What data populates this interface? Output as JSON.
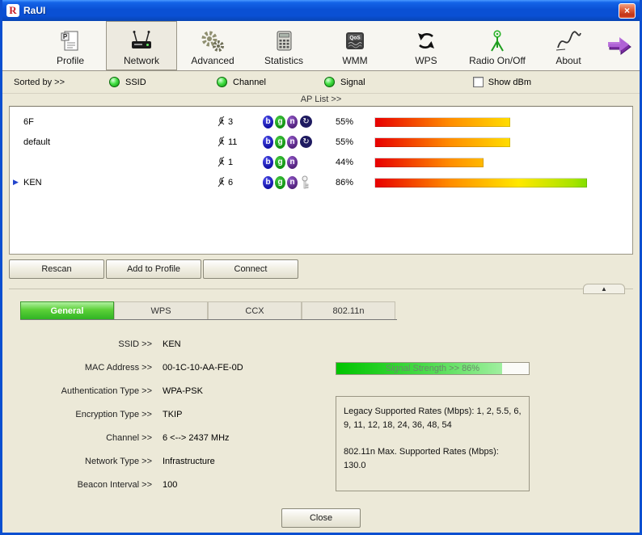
{
  "window": {
    "title": "RaUI",
    "logo": "R"
  },
  "icons": {
    "close": "×",
    "collapse": "▲",
    "connected_arrow": "▶",
    "wps_mini": "↻"
  },
  "toolbar": {
    "items": [
      {
        "label": "Profile"
      },
      {
        "label": "Network",
        "active": true
      },
      {
        "label": "Advanced"
      },
      {
        "label": "Statistics"
      },
      {
        "label": "WMM"
      },
      {
        "label": "WPS"
      },
      {
        "label": "Radio On/Off"
      },
      {
        "label": "About"
      }
    ]
  },
  "sort_bar": {
    "label": "Sorted by >>",
    "options": [
      {
        "label": "SSID"
      },
      {
        "label": "Channel"
      },
      {
        "label": "Signal"
      }
    ],
    "show_dbm": {
      "label": "Show dBm",
      "checked": false
    }
  },
  "ap_list": {
    "header": "AP List >>",
    "rows": [
      {
        "ssid": "6F",
        "channel": "3",
        "modes": [
          "b",
          "g",
          "n"
        ],
        "security": "wps",
        "signal": "55%",
        "connected": false
      },
      {
        "ssid": "default",
        "channel": "11",
        "modes": [
          "b",
          "g",
          "n"
        ],
        "security": "wps",
        "signal": "55%",
        "connected": false
      },
      {
        "ssid": "",
        "channel": "1",
        "modes": [
          "b",
          "g",
          "n"
        ],
        "security": "",
        "signal": "44%",
        "connected": false
      },
      {
        "ssid": "KEN",
        "channel": "6",
        "modes": [
          "b",
          "g",
          "n"
        ],
        "security": "key",
        "signal": "86%",
        "connected": true
      }
    ]
  },
  "actions": {
    "rescan": "Rescan",
    "add_to_profile": "Add to Profile",
    "connect": "Connect"
  },
  "detail": {
    "tabs": [
      {
        "label": "General",
        "active": true
      },
      {
        "label": "WPS"
      },
      {
        "label": "CCX"
      },
      {
        "label": "802.11n"
      }
    ],
    "fields": [
      {
        "label": "SSID >>",
        "value": "KEN"
      },
      {
        "label": "MAC Address >>",
        "value": "00-1C-10-AA-FE-0D"
      },
      {
        "label": "Authentication Type >>",
        "value": "WPA-PSK"
      },
      {
        "label": "Encryption Type >>",
        "value": "TKIP"
      },
      {
        "label": "Channel >>",
        "value": "6 <--> 2437 MHz"
      },
      {
        "label": "Network Type >>",
        "value": "Infrastructure"
      },
      {
        "label": "Beacon Interval >>",
        "value": "100"
      }
    ],
    "signal_strength": {
      "label": "Signal Strength >> 86%",
      "fill": "86%"
    },
    "rates": {
      "legacy": "Legacy Supported Rates (Mbps): 1, 2, 5.5, 6, 9, 11, 12, 18, 24, 36, 48, 54",
      "n_max": "802.11n Max. Supported Rates (Mbps): 130.0"
    }
  },
  "footer": {
    "close": "Close"
  },
  "colors": {
    "titlebar_blue": "#0A52D8",
    "active_tab_green": "#3CC02C",
    "badge_b": "#1414A8",
    "badge_g": "#149414",
    "badge_n": "#55247E",
    "signal_bar_gradient": [
      "#E80000",
      "#FFE800",
      "#20D000"
    ]
  }
}
